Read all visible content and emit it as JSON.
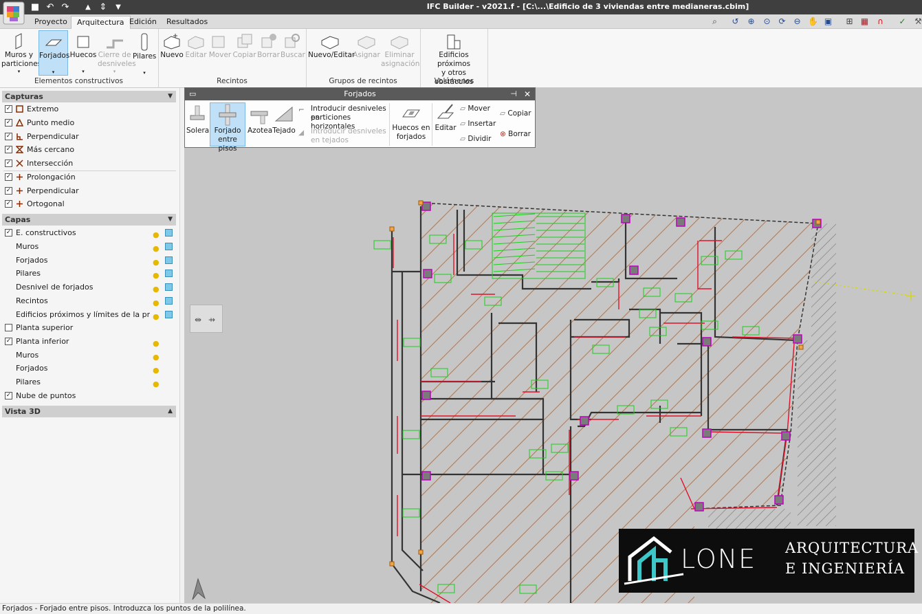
{
  "window": {
    "title": "IFC Builder - v2021.f - [C:\\...\\Edificio de 3 viviendas entre medianeras.cbim]"
  },
  "quick_access": [
    {
      "name": "save-icon",
      "glyph": "■"
    },
    {
      "name": "undo-icon",
      "glyph": "↶"
    },
    {
      "name": "redo-icon",
      "glyph": "↷"
    },
    {
      "name": "level-up-icon",
      "glyph": "▲"
    },
    {
      "name": "level-select-icon",
      "glyph": "⇕"
    },
    {
      "name": "level-down-icon",
      "glyph": "▼"
    }
  ],
  "tabs": [
    "Proyecto",
    "Arquitectura",
    "Edición",
    "Resultados"
  ],
  "active_tab": "Arquitectura",
  "ribbon": {
    "groups": [
      "Elementos constructivos",
      "Recintos",
      "Grupos de recintos",
      "Volúmenes cercanos"
    ],
    "buttons": [
      {
        "label1": "Muros y",
        "label2": "particiones",
        "arrow": "▾"
      },
      {
        "label1": "Forjados",
        "label2": "",
        "arrow": "▾"
      },
      {
        "label1": "Huecos",
        "label2": "",
        "arrow": "▾"
      },
      {
        "label1": "Cierre de",
        "label2": "desniveles",
        "arrow": "▾"
      },
      {
        "label1": "Pilares",
        "label2": "",
        "arrow": "▾"
      },
      {
        "label1": "Nuevo",
        "label2": ""
      },
      {
        "label1": "Editar",
        "label2": ""
      },
      {
        "label1": "Mover",
        "label2": ""
      },
      {
        "label1": "Copiar",
        "label2": ""
      },
      {
        "label1": "Borrar",
        "label2": ""
      },
      {
        "label1": "Buscar",
        "label2": ""
      },
      {
        "label1": "Nuevo/Editar",
        "label2": ""
      },
      {
        "label1": "Asignar",
        "label2": ""
      },
      {
        "label1": "Eliminar",
        "label2": "asignación"
      },
      {
        "label1": "Edificios próximos",
        "label2": "y otros obstáculos",
        "arrow": "▾"
      }
    ]
  },
  "sidebar": {
    "capturas_title": "Capturas",
    "capturas": [
      {
        "label": "Extremo",
        "icon": "endpoint-icon",
        "checked": "✓"
      },
      {
        "label": "Punto medio",
        "icon": "midpoint-icon",
        "checked": "✓"
      },
      {
        "label": "Perpendicular",
        "icon": "perpendicular-icon",
        "checked": "✓"
      },
      {
        "label": "Más cercano",
        "icon": "nearest-icon",
        "checked": "✓"
      },
      {
        "label": "Intersección",
        "icon": "intersection-icon",
        "checked": "✓"
      },
      {
        "label": "Prolongación",
        "icon": "plus-icon",
        "checked": "✓"
      },
      {
        "label": "Perpendicular",
        "icon": "plus-icon",
        "checked": "✓"
      },
      {
        "label": "Ortogonal",
        "icon": "plus-icon",
        "checked": "✓"
      }
    ],
    "capas_title": "Capas",
    "capas": [
      {
        "label": "E. constructivos",
        "checked": "✓",
        "has_check": true,
        "bulb": true,
        "cube": true
      },
      {
        "label": "Muros",
        "has_check": false,
        "bulb": true,
        "cube": true
      },
      {
        "label": "Forjados",
        "has_check": false,
        "bulb": true,
        "cube": true
      },
      {
        "label": "Pilares",
        "has_check": false,
        "bulb": true,
        "cube": true
      },
      {
        "label": "Desnivel de forjados",
        "has_check": false,
        "bulb": true,
        "cube": true
      },
      {
        "label": "Recintos",
        "has_check": false,
        "bulb": true,
        "cube": true
      },
      {
        "label": "Edificios próximos y límites de la propiedad",
        "has_check": false,
        "bulb": true,
        "cube": true
      },
      {
        "label": "Planta superior",
        "checked": "",
        "has_check": true,
        "bulb": false,
        "cube": false
      },
      {
        "label": "Planta inferior",
        "checked": "✓",
        "has_check": true,
        "bulb": true,
        "cube": false
      },
      {
        "label": "Muros",
        "has_check": false,
        "bulb": true,
        "cube": false
      },
      {
        "label": "Forjados",
        "has_check": false,
        "bulb": true,
        "cube": false
      },
      {
        "label": "Pilares",
        "has_check": false,
        "bulb": true,
        "cube": false
      },
      {
        "label": "Nube de puntos",
        "checked": "✓",
        "has_check": true,
        "bulb": false,
        "cube": false
      }
    ],
    "vista_title": "Vista 3D"
  },
  "forjados_panel": {
    "title": "Forjados",
    "solera": "Solera",
    "forjado1": "Forjado",
    "forjado2": "entre pisos",
    "azotea": "Azotea",
    "tejado": "Tejado",
    "desnivel_h1": "Introducir desniveles en",
    "desnivel_h2": "particiones horizontales",
    "desnivel_t1": "Introducir desniveles",
    "desnivel_t2": "en tejados",
    "huecos1": "Huecos en",
    "huecos2": "forjados",
    "editar": "Editar",
    "mover": "Mover",
    "insertar": "Insertar",
    "dividir": "Dividir",
    "copiar": "Copiar",
    "borrar": "Borrar"
  },
  "status": "Forjados - Forjado entre pisos. Introduzca los puntos de la polilínea.",
  "logo": {
    "word": "LONE",
    "line1": "ARQUITECTURA",
    "line2": "E INGENIERÍA"
  },
  "colors": {
    "accent": "#bfe0f7",
    "wall": "#3a3a3a",
    "red": "#e0102a",
    "green": "#17d01a",
    "hatch": "#c8743a",
    "magenta": "#c000c0"
  }
}
